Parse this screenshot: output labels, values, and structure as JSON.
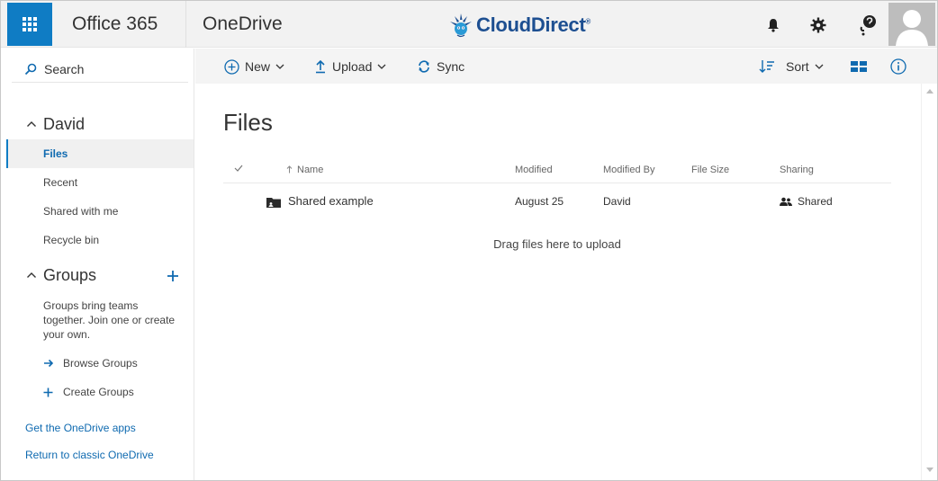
{
  "suite": {
    "app_launcher_icon": "waffle-icon",
    "product": "Office 365",
    "app": "OneDrive",
    "logo": {
      "name": "Cloud Direct",
      "text_part1": "Cloud",
      "text_part2": "Direct",
      "registered": "®"
    },
    "icons": [
      "bell-icon",
      "gear-icon",
      "help-icon",
      "avatar"
    ]
  },
  "nav": {
    "search_label": "Search",
    "user_section": "David",
    "items": [
      {
        "label": "Files",
        "selected": true
      },
      {
        "label": "Recent"
      },
      {
        "label": "Shared with me"
      },
      {
        "label": "Recycle bin"
      }
    ],
    "groups_section": "Groups",
    "groups_text": "Groups bring teams together. Join one or create your own.",
    "browse_groups": "Browse Groups",
    "create_groups": "Create Groups",
    "get_apps": "Get the OneDrive apps",
    "return_classic": "Return to classic OneDrive"
  },
  "commands": {
    "new_label": "New",
    "upload_label": "Upload",
    "sync_label": "Sync",
    "sort_label": "Sort"
  },
  "main": {
    "title": "Files",
    "columns": {
      "name": "Name",
      "modified": "Modified",
      "modified_by": "Modified By",
      "file_size": "File Size",
      "sharing": "Sharing"
    },
    "rows": [
      {
        "name": "Shared example",
        "modified": "August 25",
        "modified_by": "David",
        "file_size": "",
        "sharing": "Shared"
      }
    ],
    "drag_hint": "Drag files here to upload"
  },
  "colors": {
    "accent": "#0f7cc4",
    "link": "#0f6ab0",
    "suite_bg": "#f2f2f2",
    "cmd_bg": "#f4f4f4"
  }
}
